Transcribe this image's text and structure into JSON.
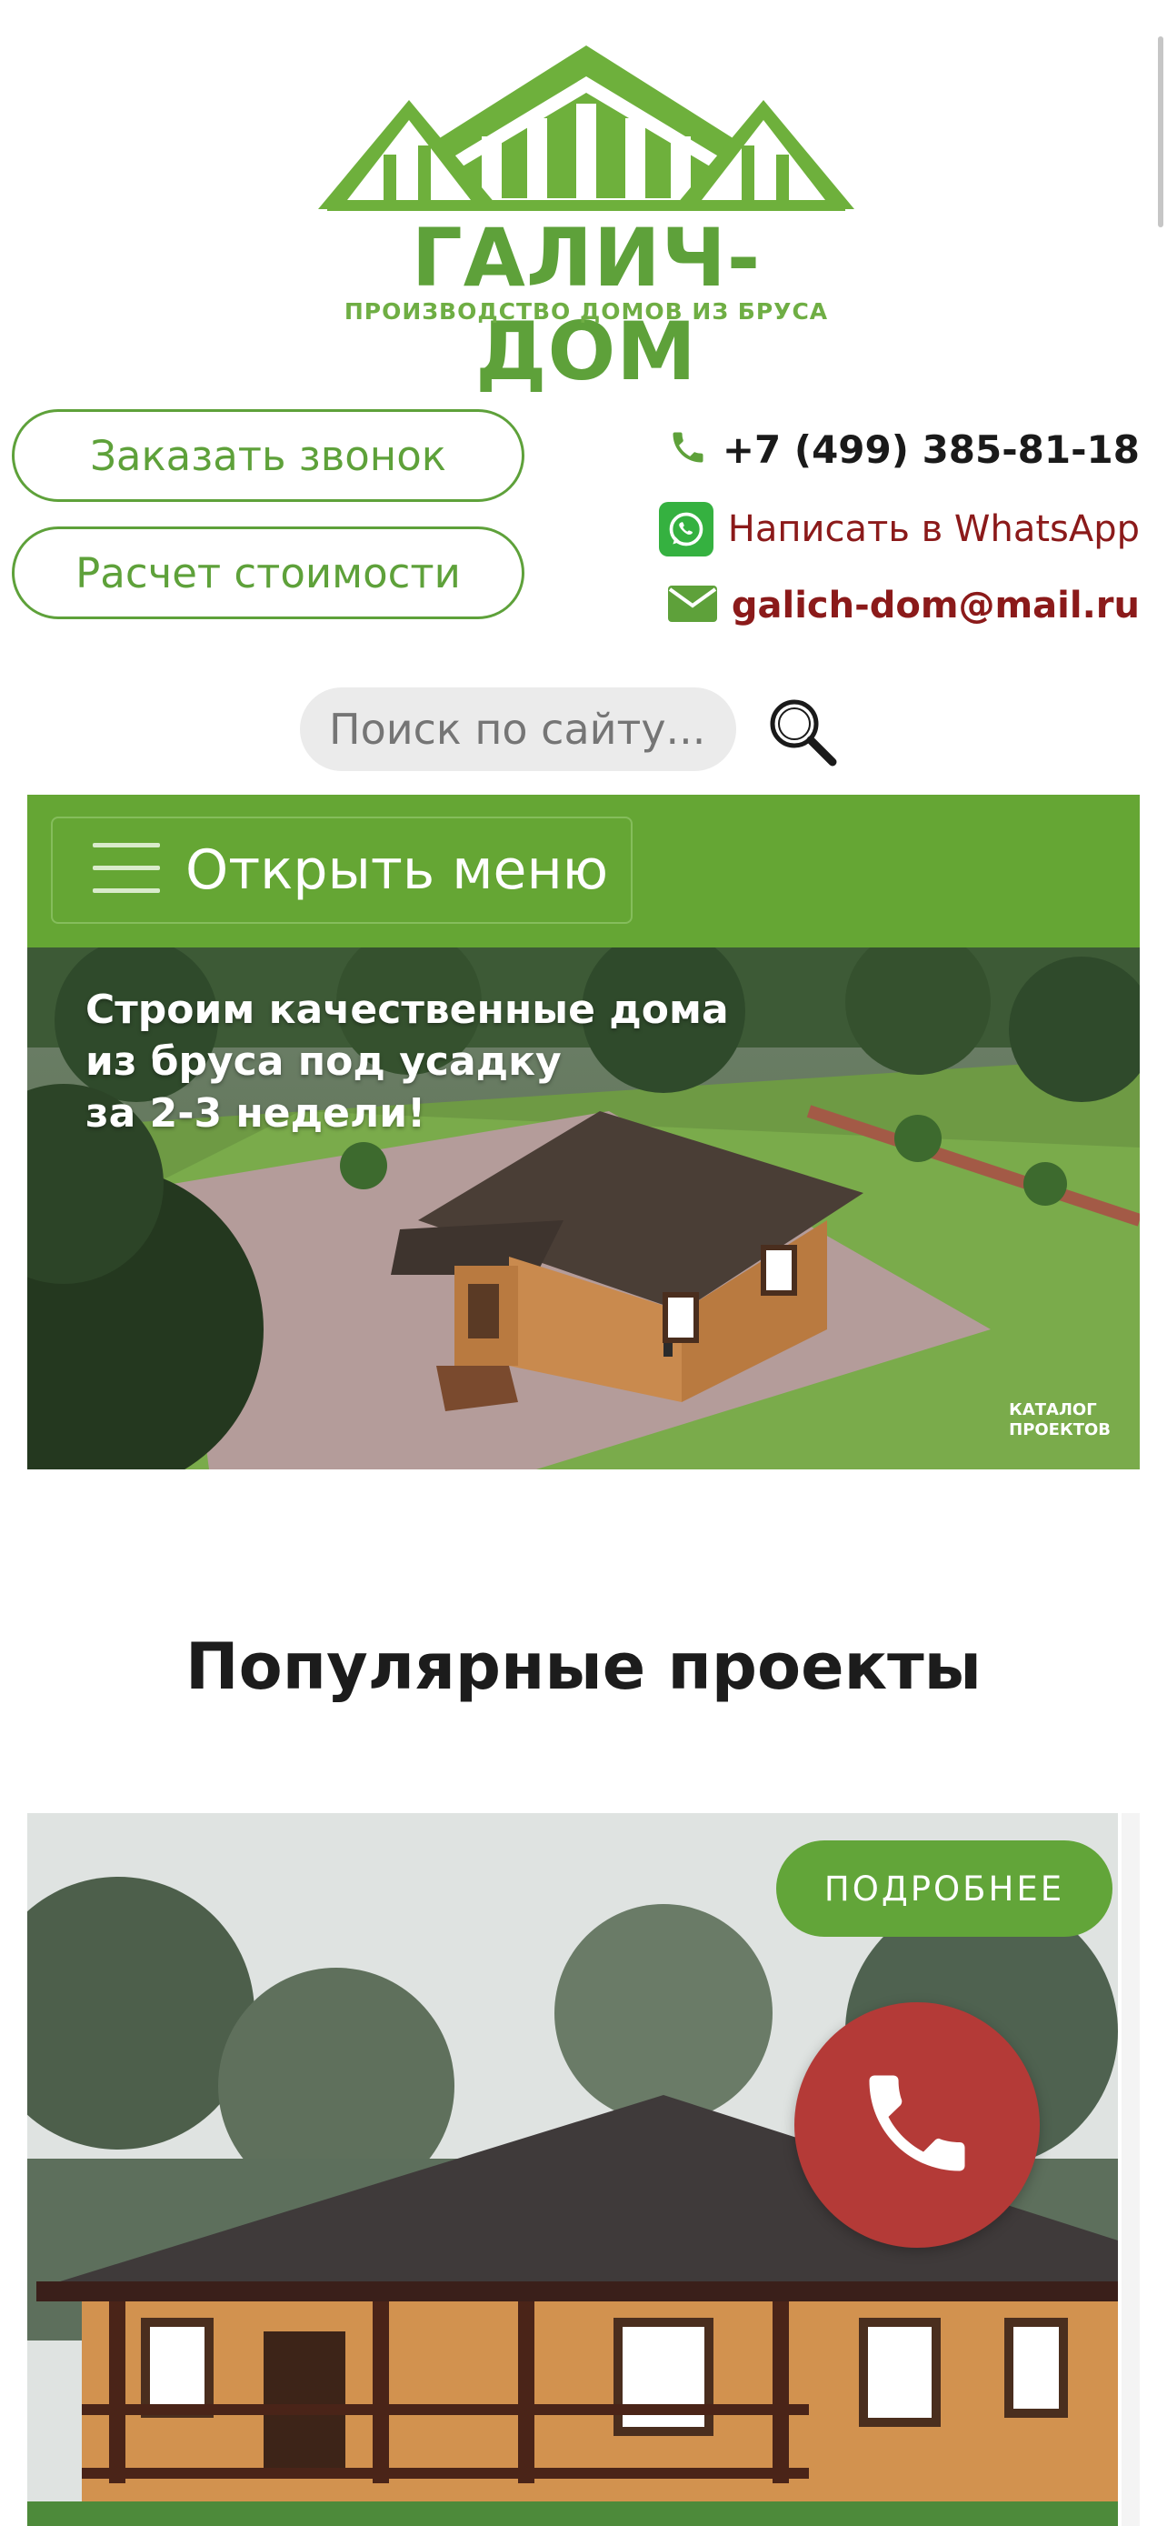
{
  "logo": {
    "title": "ГАЛИЧ-ДОМ",
    "subtitle": "ПРОИЗВОДСТВО ДОМОВ ИЗ БРУСА",
    "color": "#5ea13a"
  },
  "actions": {
    "order_call": "Заказать звонок",
    "price_calc": "Расчет стоимости"
  },
  "contacts": {
    "phone": "+7 (499) 385-81-18",
    "whatsapp": "Написать в WhatsApp",
    "email": "galich-dom@mail.ru"
  },
  "search": {
    "placeholder": "Поиск по сайту..."
  },
  "menu": {
    "open_label": "Открыть меню"
  },
  "hero": {
    "title_lines": [
      "Строим качественные дома",
      "из бруса под усадку",
      "за 2-3 недели!"
    ],
    "catalog_lines": [
      "КАТАЛОГ",
      "ПРОЕКТОВ"
    ]
  },
  "popular": {
    "title": "Популярные проекты",
    "details_label": "ПОДРОБНЕЕ"
  },
  "colors": {
    "brand_green": "#65a634",
    "accent_red": "#8b1a1a",
    "call_fab": "#b43a37"
  },
  "icons": {
    "phone": "phone-icon",
    "whatsapp": "whatsapp-icon",
    "email": "envelope-icon",
    "search": "search-icon",
    "menu": "hamburger-icon",
    "call_fab": "phone-icon"
  }
}
